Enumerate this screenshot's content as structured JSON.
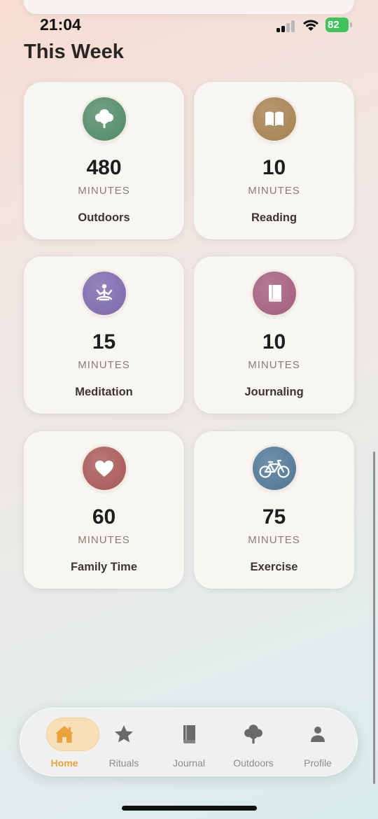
{
  "status_bar": {
    "time": "21:04",
    "battery": "82"
  },
  "page_title": "This Week",
  "cards": [
    {
      "value": "480",
      "unit": "MINUTES",
      "label": "Outdoors",
      "icon": "tree-icon",
      "color": "#4f8b67"
    },
    {
      "value": "10",
      "unit": "MINUTES",
      "label": "Reading",
      "icon": "book-open-icon",
      "color": "#a5824f"
    },
    {
      "value": "15",
      "unit": "MINUTES",
      "label": "Meditation",
      "icon": "meditation-icon",
      "color": "#7b68ad"
    },
    {
      "value": "10",
      "unit": "MINUTES",
      "label": "Journaling",
      "icon": "journal-icon",
      "color": "#a35d7c"
    },
    {
      "value": "60",
      "unit": "MINUTES",
      "label": "Family Time",
      "icon": "heart-icon",
      "color": "#a85856"
    },
    {
      "value": "75",
      "unit": "MINUTES",
      "label": "Exercise",
      "icon": "bicycle-icon",
      "color": "#4d7696"
    }
  ],
  "tab_bar": {
    "active_color": "#eaa23e",
    "items": [
      {
        "label": "Home",
        "icon": "home-icon"
      },
      {
        "label": "Rituals",
        "icon": "star-icon"
      },
      {
        "label": "Journal",
        "icon": "journal-icon"
      },
      {
        "label": "Outdoors",
        "icon": "tree-icon"
      },
      {
        "label": "Profile",
        "icon": "person-icon"
      }
    ]
  }
}
